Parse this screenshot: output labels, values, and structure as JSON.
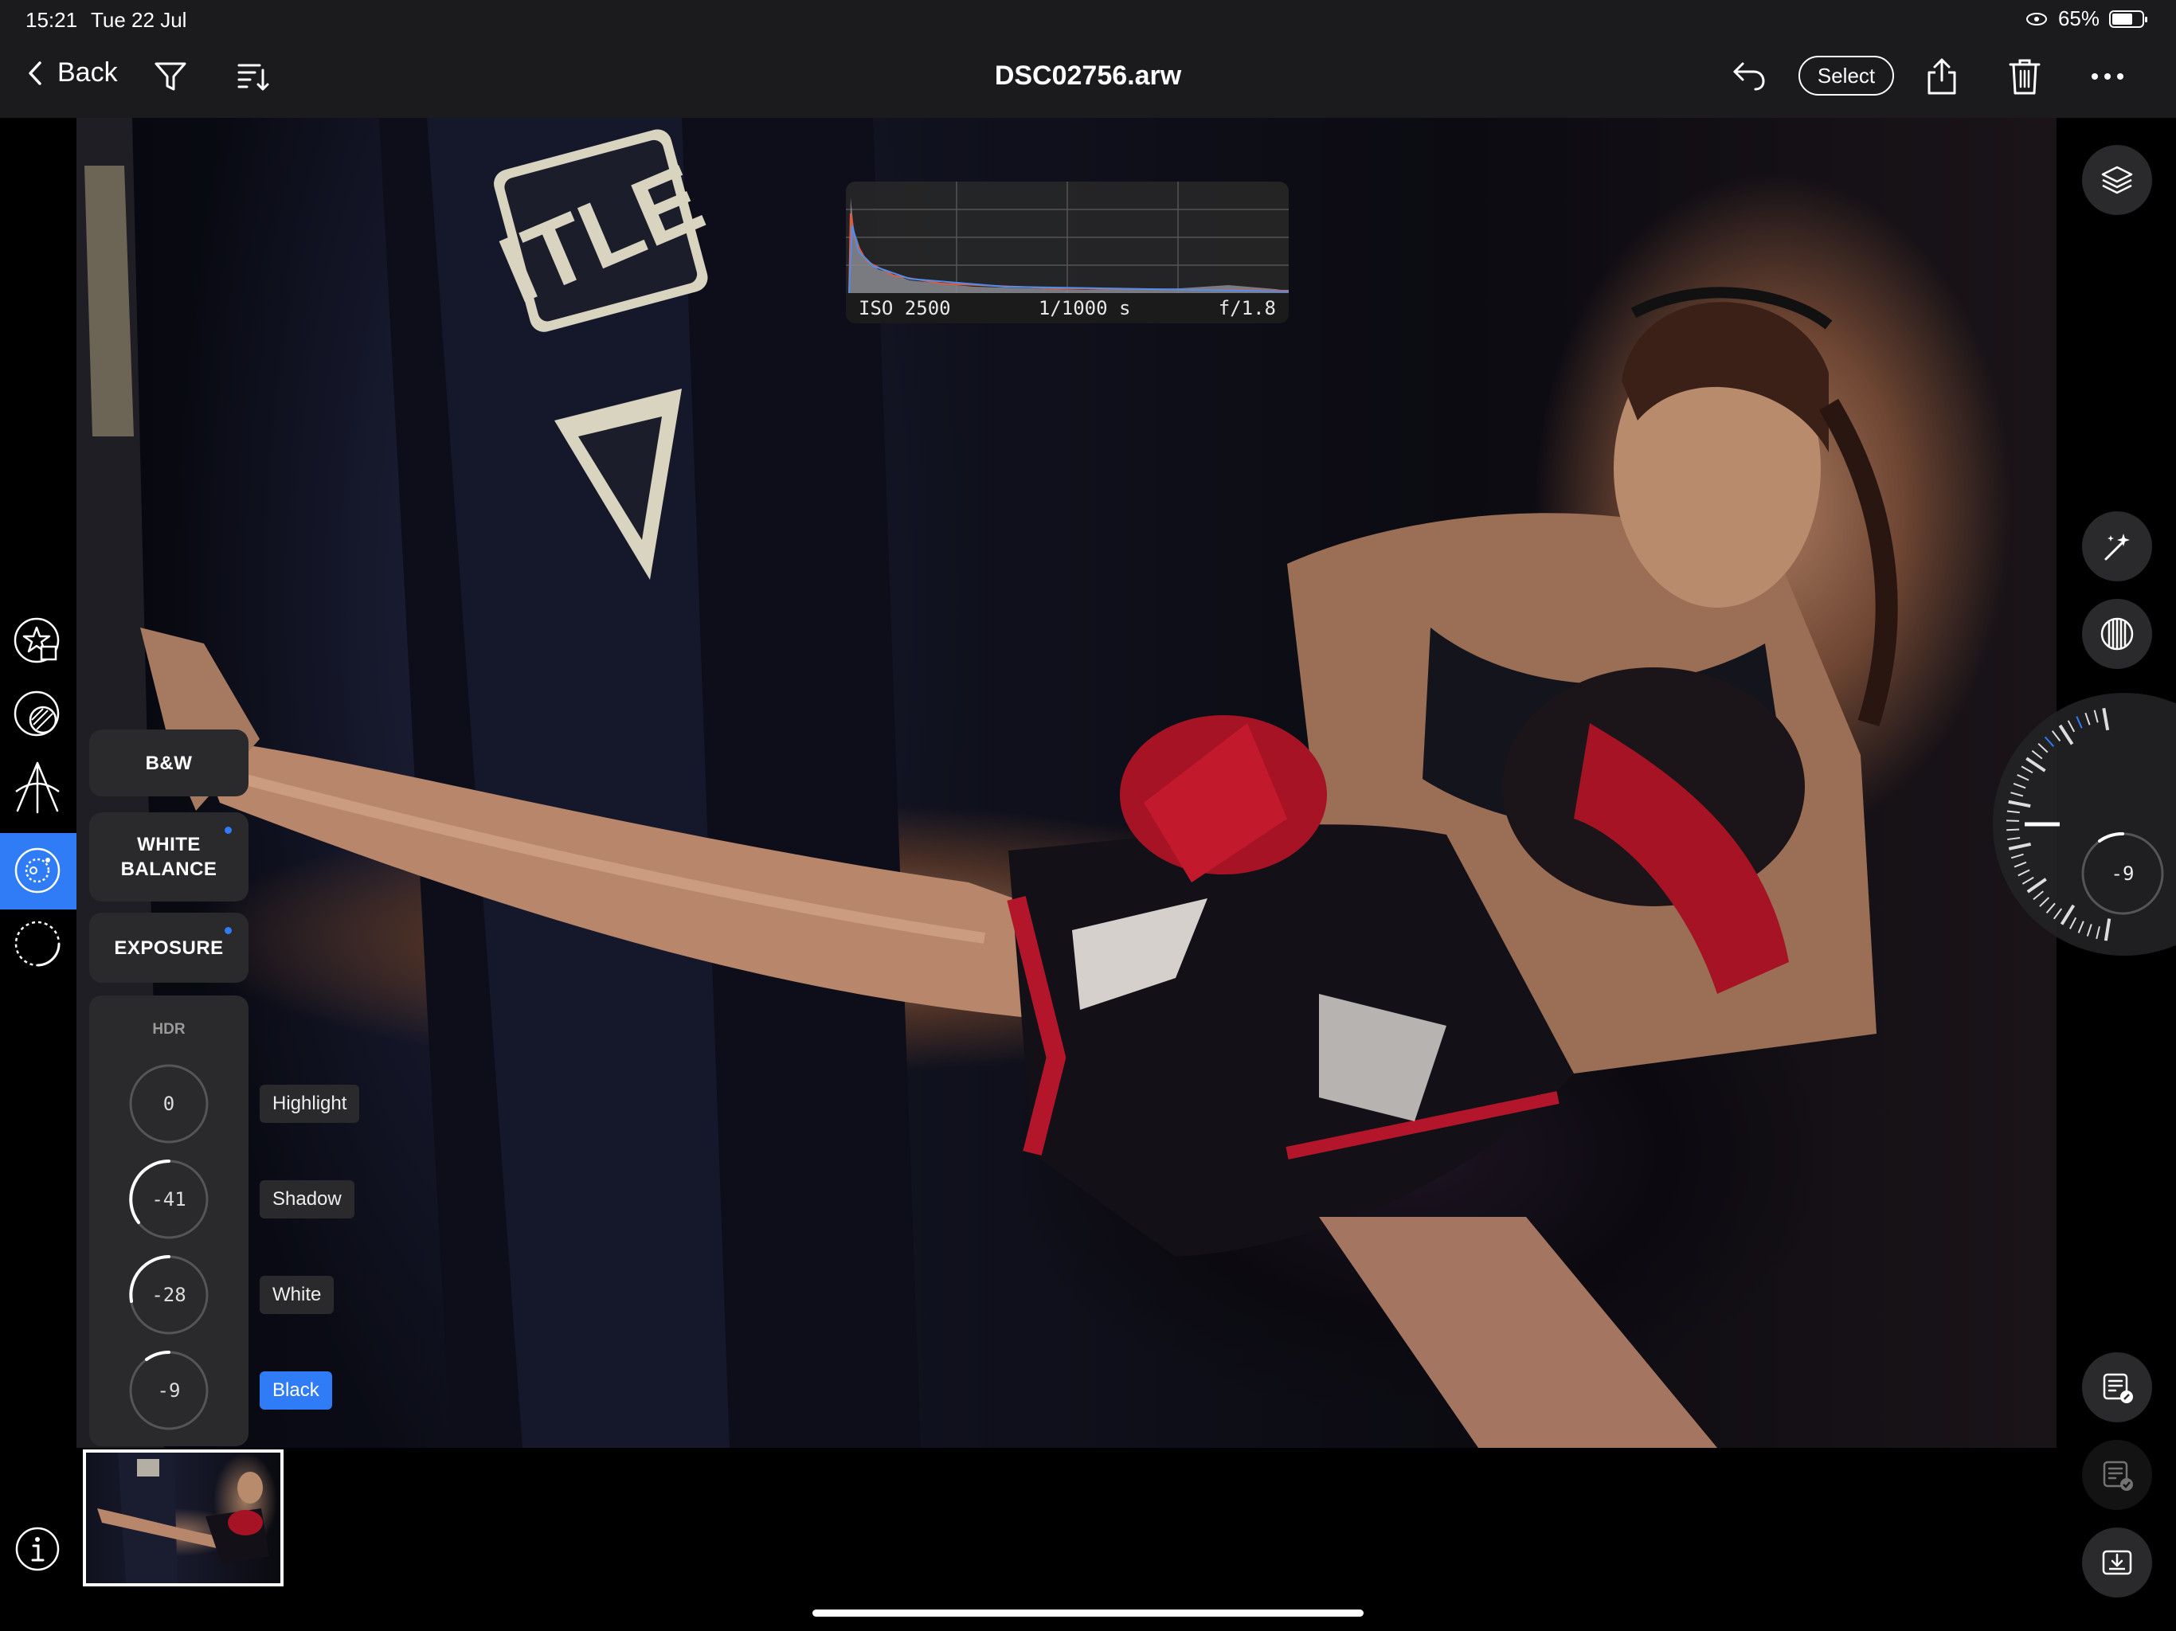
{
  "status_bar": {
    "time": "15:21",
    "date": "Tue 22 Jul",
    "battery": "65%",
    "battery_level": 0.65
  },
  "toolbar": {
    "back_label": "Back",
    "title": "DSC02756.arw",
    "select_label": "Select",
    "icons": [
      "chevron-left-icon",
      "filter-icon",
      "sort-icon",
      "undo-icon",
      "share-icon",
      "trash-icon",
      "more-icon"
    ]
  },
  "left_tools": [
    "star-crop-icon",
    "mask-icon",
    "perspective-icon",
    "tone-icon",
    "vignette-icon",
    "info-icon"
  ],
  "histogram": {
    "iso": "ISO 2500",
    "shutter": "1/1000 s",
    "aperture": "f/1.8"
  },
  "controls": {
    "bw_label": "B&W",
    "wb_label_1": "WHITE",
    "wb_label_2": "BALANCE",
    "exposure_label": "EXPOSURE",
    "hdr_title": "HDR",
    "dials": [
      {
        "label": "Highlight",
        "value": "0",
        "active": false
      },
      {
        "label": "Shadow",
        "value": "-41",
        "active": false
      },
      {
        "label": "White",
        "value": "-28",
        "active": false
      },
      {
        "label": "Black",
        "value": "-9",
        "active": true
      }
    ]
  },
  "right_tools": [
    "layers-icon",
    "magic-wand-icon",
    "pattern-icon",
    "adjust-copy-icon",
    "adjust-paste-icon",
    "export-icon"
  ],
  "wheel": {
    "value": "-9"
  },
  "colors": {
    "accent": "#2f7cf6",
    "panel": "#2a2a2c",
    "toolbar": "#1b1b1d"
  }
}
